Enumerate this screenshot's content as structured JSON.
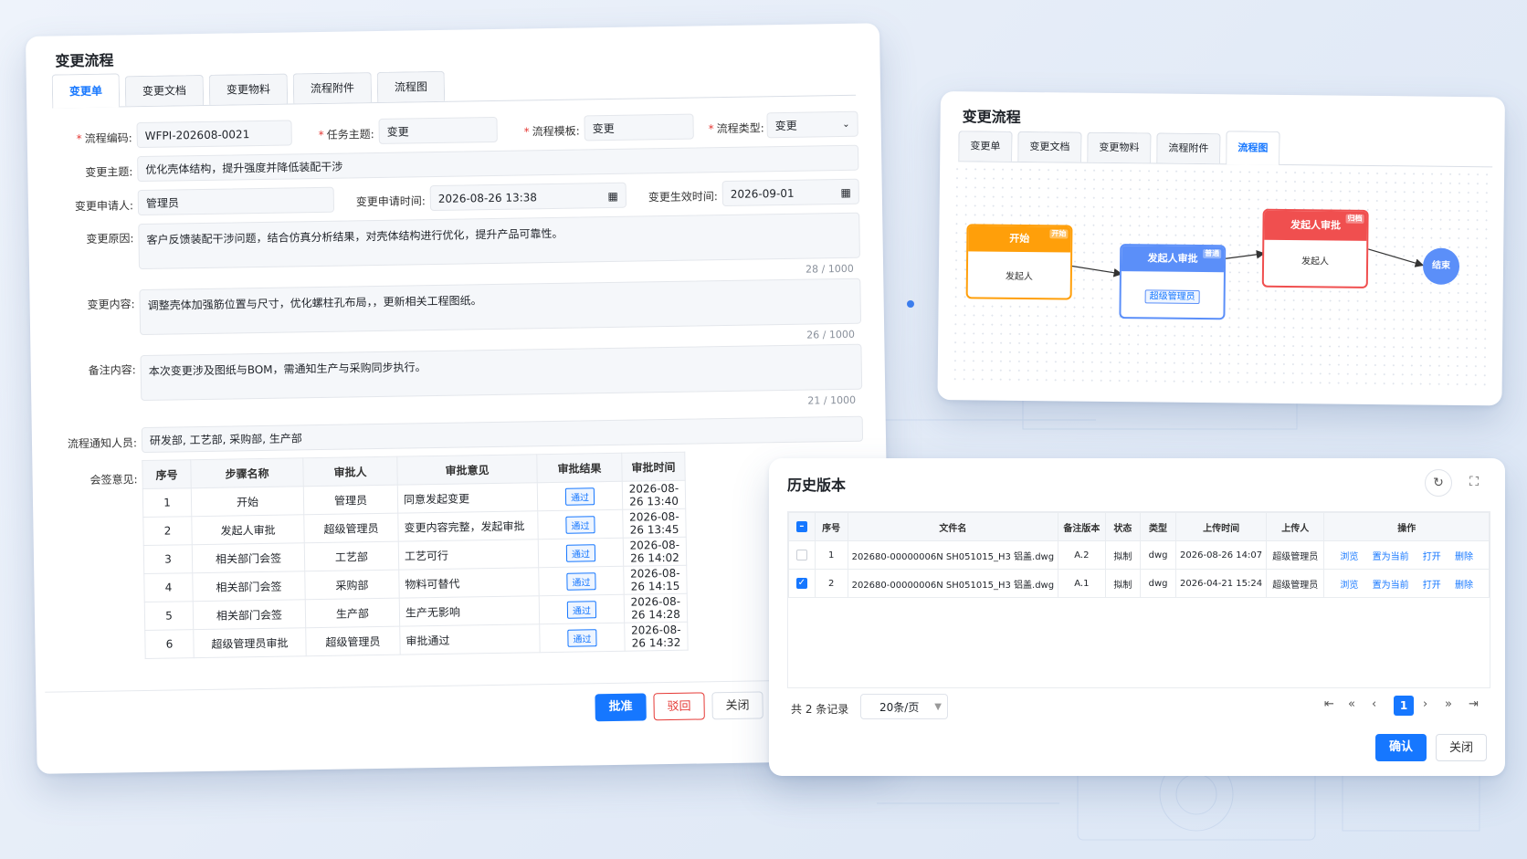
{
  "main_dialog": {
    "title": "变更流程",
    "tabs": [
      {
        "label": "变更单"
      },
      {
        "label": "变更文档"
      },
      {
        "label": "变更物料"
      },
      {
        "label": "流程附件"
      },
      {
        "label": "流程图"
      }
    ],
    "form": {
      "flow_code_label": "流程编码:",
      "flow_code_value": "WFPI-202608-0021",
      "task_subject_label": "任务主题:",
      "task_subject_value": "变更",
      "flow_template_label": "流程模板:",
      "flow_template_value": "变更",
      "flow_type_label": "流程类型:",
      "flow_type_value": "变更",
      "change_subject_label": "变更主题:",
      "change_subject_value": "优化壳体结构，提升强度并降低装配干涉",
      "applicant_label": "变更申请人:",
      "applicant_value": "管理员",
      "apply_time_label": "变更申请时间:",
      "apply_time_value": "2026-08-26 13:38",
      "effective_time_label": "变更生效时间:",
      "effective_time_value": "2026-09-01",
      "reason_label": "变更原因:",
      "reason_value": "客户反馈装配干涉问题，结合仿真分析结果，对壳体结构进行优化，提升产品可靠性。",
      "reason_count": "28 / 1000",
      "content_label": "变更内容:",
      "content_value": "调整壳体加强筋位置与尺寸，优化螺柱孔布局，，更新相关工程图纸。",
      "content_count": "26 / 1000",
      "remark_label": "备注内容:",
      "remark_value": "本次变更涉及图纸与BOM，需通知生产与采购同步执行。",
      "remark_count": "21 / 1000",
      "notify_label": "流程通知人员:",
      "notify_value": "研发部, 工艺部, 采购部, 生产部",
      "countersign_label": "会签意见:"
    },
    "sign_table": {
      "headers": [
        "序号",
        "步骤名称",
        "审批人",
        "审批意见",
        "审批结果",
        "审批时间"
      ],
      "rows": [
        {
          "no": "1",
          "step": "开始",
          "approver": "管理员",
          "opinion": "同意发起变更",
          "result": "通过",
          "time": "2026-08-26 13:40"
        },
        {
          "no": "2",
          "step": "发起人审批",
          "approver": "超级管理员",
          "opinion": "变更内容完整，发起审批",
          "result": "通过",
          "time": "2026-08-26 13:45"
        },
        {
          "no": "3",
          "step": "相关部门会签",
          "approver": "工艺部",
          "opinion": "工艺可行",
          "result": "通过",
          "time": "2026-08-26 14:02"
        },
        {
          "no": "4",
          "step": "相关部门会签",
          "approver": "采购部",
          "opinion": "物料可替代",
          "result": "通过",
          "time": "2026-08-26 14:15"
        },
        {
          "no": "5",
          "step": "相关部门会签",
          "approver": "生产部",
          "opinion": "生产无影响",
          "result": "通过",
          "time": "2026-08-26 14:28"
        },
        {
          "no": "6",
          "step": "超级管理员审批",
          "approver": "超级管理员",
          "opinion": "审批通过",
          "result": "通过",
          "time": "2026-08-26 14:32"
        }
      ]
    },
    "buttons": {
      "approve": "批准",
      "reject": "驳回",
      "close": "关闭"
    }
  },
  "flow_dialog": {
    "title": "变更流程",
    "tabs": [
      {
        "label": "变更单"
      },
      {
        "label": "变更文档"
      },
      {
        "label": "变更物料"
      },
      {
        "label": "流程附件"
      },
      {
        "label": "流程图"
      }
    ],
    "nodes": {
      "start": {
        "title": "开始",
        "tag": "开始",
        "body": "发起人",
        "color": "#ff9f0a"
      },
      "initiator": {
        "title": "发起人审批",
        "tag": "普通",
        "body": "超级管理员",
        "color": "#5b8ff9"
      },
      "initiator2": {
        "title": "发起人审批",
        "tag": "归档",
        "body": "发起人",
        "color": "#f04f4f"
      },
      "end": {
        "title": "结束",
        "color": "#5b8ff9"
      }
    }
  },
  "history_dialog": {
    "title": "历史版本",
    "headers": [
      "序号",
      "文件名",
      "备注版本",
      "状态",
      "类型",
      "上传时间",
      "上传人",
      "操作"
    ],
    "rows": [
      {
        "no": "1",
        "file": "202680-00000006N SH051015_H3 铝盖.dwg",
        "version": "A.2",
        "status": "拟制",
        "type": "dwg",
        "time": "2026-08-26 14:07",
        "uploader": "超级管理员",
        "checked": false
      },
      {
        "no": "2",
        "file": "202680-00000006N SH051015_H3 铝盖.dwg",
        "version": "A.1",
        "status": "拟制",
        "type": "dwg",
        "time": "2026-04-21 15:24",
        "uploader": "超级管理员",
        "checked": true
      }
    ],
    "ops": {
      "browse": "浏览",
      "set_current": "置为当前",
      "open": "打开",
      "delete": "删除"
    },
    "total": "共 2 条记录",
    "page_size": "20条/页",
    "current_page": "1",
    "buttons": {
      "confirm": "确认",
      "close": "关闭"
    }
  }
}
